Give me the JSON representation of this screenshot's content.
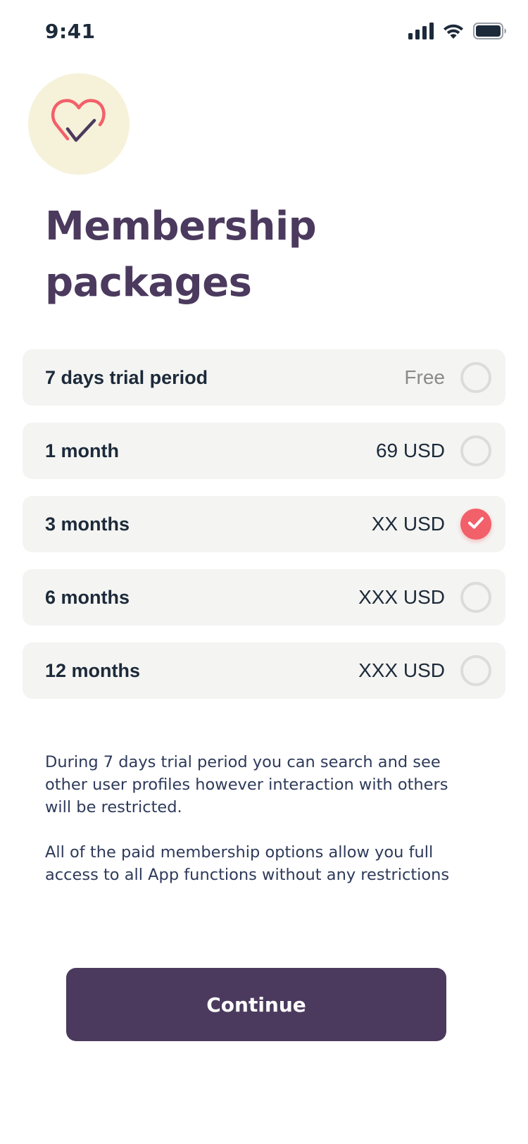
{
  "status_bar": {
    "time": "9:41",
    "icons": [
      "signal-icon",
      "wifi-icon",
      "battery-icon"
    ]
  },
  "logo": {
    "icon": "heart-check-icon",
    "colors": {
      "background": "#f6f1d9",
      "heart": "#f2606a",
      "check": "#4b3a5e"
    }
  },
  "title": "Membership packages",
  "packages": [
    {
      "name": "7 days trial period",
      "price": "Free",
      "selected": false
    },
    {
      "name": "1 month",
      "price": "69 USD",
      "selected": false
    },
    {
      "name": "3 months",
      "price": "XX USD",
      "selected": true
    },
    {
      "name": "6 months",
      "price": "XXX USD",
      "selected": false
    },
    {
      "name": "12 months",
      "price": "XXX USD",
      "selected": false
    }
  ],
  "description": {
    "paragraph_1": "During 7 days trial period you can search and see other user profiles however interaction with others will be restricted.",
    "paragraph_2": "All of the paid membership options allow you full access to all App functions without any restrictions"
  },
  "continue_label": "Continue",
  "colors": {
    "primary": "#4b3a5e",
    "accent": "#f2606a",
    "row_background": "#f4f4f2"
  }
}
